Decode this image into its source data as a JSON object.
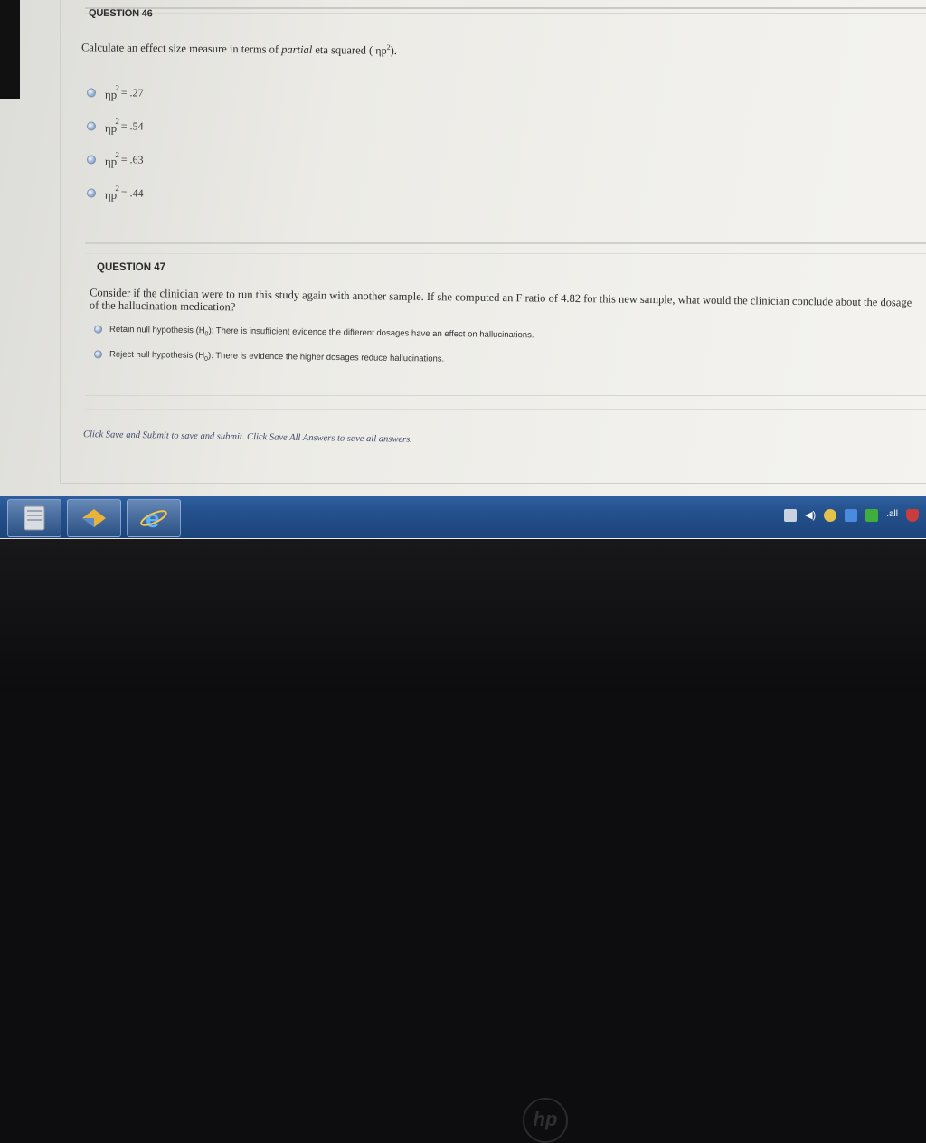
{
  "question46": {
    "header": "QUESTION 46",
    "prompt_before": "Calculate an effect size measure in terms of ",
    "prompt_italic": "partial",
    "prompt_after": " eta squared (",
    "eta_symbol": "ηp",
    "superscript": "2",
    "prompt_close": ").",
    "options": [
      {
        "symbol": "ηp",
        "sup": "2",
        "value": "= .27"
      },
      {
        "symbol": "ηp",
        "sup": "2",
        "value": "= .54"
      },
      {
        "symbol": "ηp",
        "sup": "2",
        "value": "= .63"
      },
      {
        "symbol": "ηp",
        "sup": "2",
        "value": "= .44"
      }
    ]
  },
  "question47": {
    "header": "QUESTION 47",
    "prompt": "Consider if the clinician were to run this study again with another sample. If she computed an F ratio of 4.82 for this new sample, what would the clinician conclude about the dosage of the hallucination medication?",
    "options": [
      {
        "pre": "Retain null hypothesis (H",
        "sub": "0",
        "post": "): There is insufficient evidence the different dosages have an effect on hallucinations."
      },
      {
        "pre": "Reject null hypothesis (H",
        "sub": "0",
        "post": "): There is evidence the higher dosages reduce hallucinations."
      }
    ]
  },
  "footer": {
    "note": "Click Save and Submit to save and submit. Click Save All Answers to save all answers."
  },
  "taskbar": {
    "buttons": [
      "file-manager-icon",
      "media-icon",
      "internet-explorer-icon"
    ],
    "tray_icons": [
      "action-center-icon",
      "volume-icon",
      "network-icon",
      "app-icon",
      "signal-icon",
      "security-icon"
    ],
    "signal_text": ".all"
  },
  "bezel": {
    "logo_text": "hp"
  },
  "colors": {
    "taskbar": "#23508c",
    "link": "#3f4a6a"
  }
}
